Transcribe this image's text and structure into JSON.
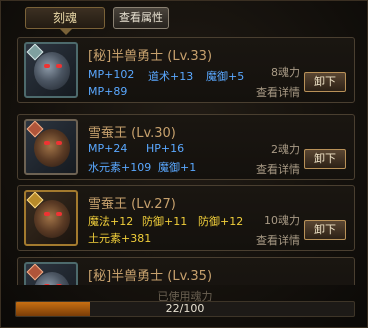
{
  "tabs": {
    "engrave": "刻魂",
    "view_attrs": "查看属性"
  },
  "cards": [
    {
      "name": "[秘]半兽勇士 (Lv.33)",
      "stats": [
        [
          "MP+102",
          "道术+13",
          "魔御+5"
        ],
        [
          "MP+89"
        ]
      ],
      "souls": "8魂力",
      "detail": "查看详情",
      "button": "卸下",
      "color": "blue"
    },
    {
      "name": "雪蚕王 (Lv.30)",
      "stats": [
        [
          "MP+24",
          "HP+16"
        ],
        [
          "水元素+109",
          "魔御+1"
        ]
      ],
      "souls": "2魂力",
      "detail": "查看详情",
      "button": "卸下",
      "color": "blue"
    },
    {
      "name": "雪蚕王 (Lv.27)",
      "stats": [
        [
          "魔法+12",
          "防御+11",
          "防御+12"
        ],
        [
          "土元素+381"
        ]
      ],
      "souls": "10魂力",
      "detail": "查看详情",
      "button": "卸下",
      "color": "yellow"
    },
    {
      "name": "[秘]半兽勇士 (Lv.35)"
    }
  ],
  "power": {
    "label": "已使用魂力",
    "text": "22/100",
    "used": 22,
    "max": 100
  }
}
